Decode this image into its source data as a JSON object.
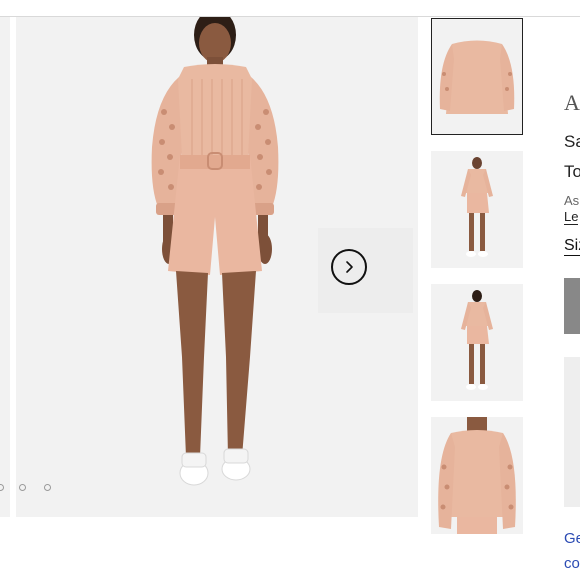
{
  "gallery": {
    "next_icon": "chevron-right-icon",
    "dots": 3
  },
  "thumbnails": [
    {
      "label": "front crop",
      "selected": true
    },
    {
      "label": "full front",
      "selected": false
    },
    {
      "label": "full back",
      "selected": false
    },
    {
      "label": "detail",
      "selected": false
    }
  ],
  "product": {
    "brand_partial": "A",
    "name_partial_1": "Sa",
    "name_partial_2": "To",
    "note_partial": "As",
    "link_partial": "Le",
    "size_label_partial": "Siz",
    "link_bottom_1": "Ge",
    "link_bottom_2": "co"
  },
  "colors": {
    "garment": "#e9b9a1",
    "garment_shadow": "#d9a188",
    "skin": "#8a5a40",
    "link": "#2b4bb3"
  }
}
